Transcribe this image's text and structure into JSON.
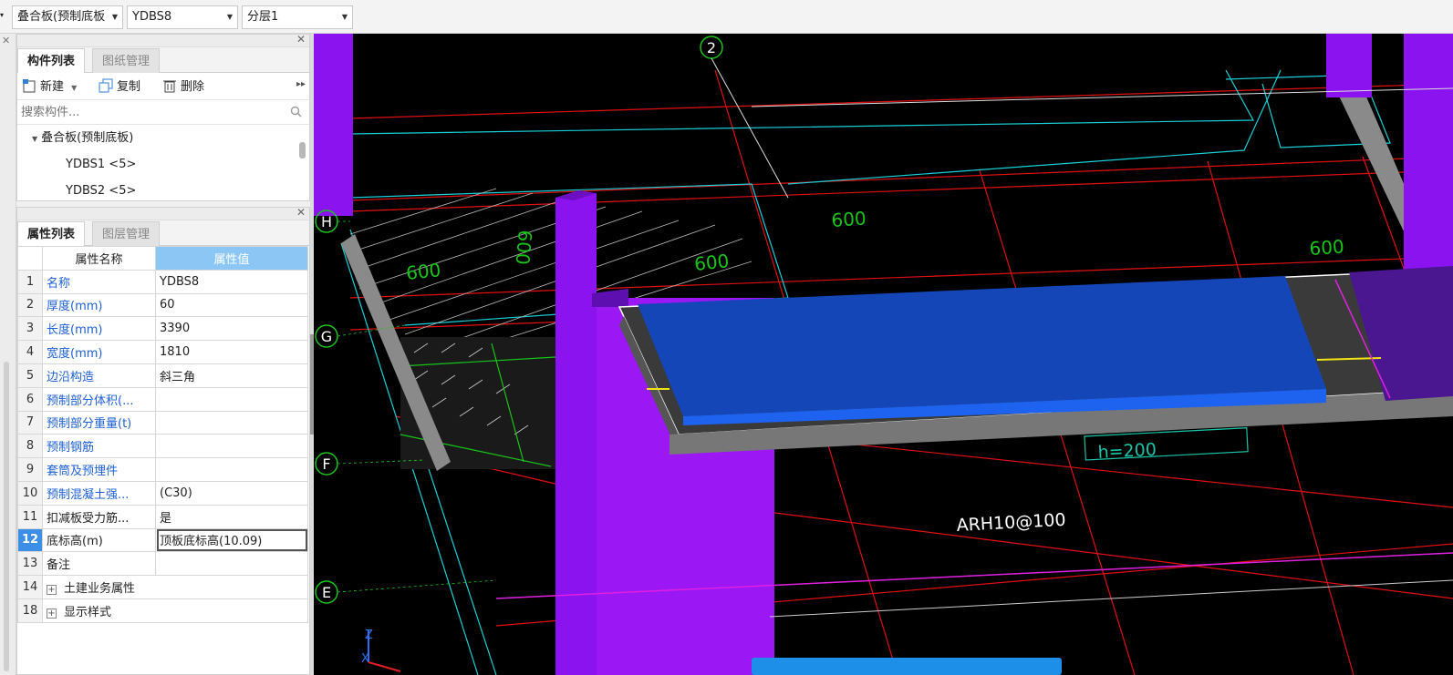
{
  "toolbar": {
    "combo1": "叠合板(预制底板",
    "combo2": "YDBS8",
    "combo3": "分层1"
  },
  "component_panel": {
    "tabs": [
      "构件列表",
      "图纸管理"
    ],
    "new_label": "新建",
    "copy_label": "复制",
    "delete_label": "删除",
    "search_placeholder": "搜索构件...",
    "tree": {
      "group": "叠合板(预制底板)",
      "items": [
        "YDBS1 <5>",
        "YDBS2 <5>"
      ]
    }
  },
  "property_panel": {
    "tabs": [
      "属性列表",
      "图层管理"
    ],
    "col_name": "属性名称",
    "col_value": "属性值",
    "rows": [
      {
        "n": "1",
        "name": "名称",
        "value": "YDBS8"
      },
      {
        "n": "2",
        "name": "厚度(mm)",
        "value": "60"
      },
      {
        "n": "3",
        "name": "长度(mm)",
        "value": "3390"
      },
      {
        "n": "4",
        "name": "宽度(mm)",
        "value": "1810"
      },
      {
        "n": "5",
        "name": "边沿构造",
        "value": "斜三角"
      },
      {
        "n": "6",
        "name": "预制部分体积(...",
        "value": ""
      },
      {
        "n": "7",
        "name": "预制部分重量(t)",
        "value": ""
      },
      {
        "n": "8",
        "name": "预制钢筋",
        "value": ""
      },
      {
        "n": "9",
        "name": "套筒及预埋件",
        "value": ""
      },
      {
        "n": "10",
        "name": "预制混凝土强...",
        "value": "(C30)"
      },
      {
        "n": "11",
        "name": "扣减板受力筋...",
        "value": "是"
      },
      {
        "n": "12",
        "name": "底标高(m)",
        "value": "顶板底标高(10.09)"
      },
      {
        "n": "13",
        "name": "备注",
        "value": ""
      },
      {
        "n": "14",
        "name": "土建业务属性",
        "value": ""
      },
      {
        "n": "18",
        "name": "显示样式",
        "value": ""
      }
    ]
  },
  "viewport": {
    "axis_labels": [
      "2",
      "H",
      "G",
      "F",
      "E"
    ],
    "dims": [
      "600",
      "600",
      "600",
      "600",
      "600"
    ],
    "annotations": [
      "h=200",
      "ARH10@100"
    ],
    "axis_gizmo": [
      "Z",
      "X"
    ]
  }
}
